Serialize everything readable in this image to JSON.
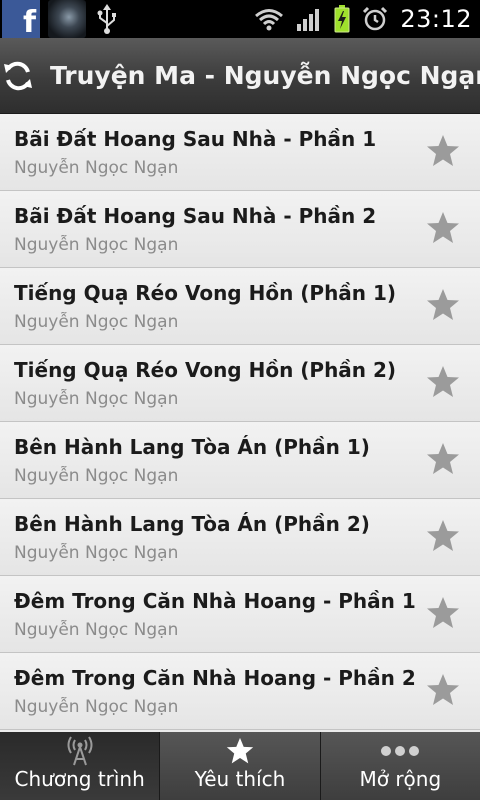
{
  "status_bar": {
    "facebook_icon": "facebook-icon",
    "time": "23:12"
  },
  "header": {
    "title": "Truyện Ma - Nguyễn Ngọc Ngạn",
    "refresh_icon": "refresh-icon"
  },
  "list": {
    "items": [
      {
        "title": "Bãi Đất Hoang Sau Nhà - Phần 1",
        "author": "Nguyễn Ngọc Ngạn"
      },
      {
        "title": "Bãi Đất Hoang Sau Nhà - Phần 2",
        "author": "Nguyễn Ngọc Ngạn"
      },
      {
        "title": "Tiếng Quạ Réo Vong Hồn (Phần 1)",
        "author": "Nguyễn Ngọc Ngạn"
      },
      {
        "title": "Tiếng Quạ Réo Vong Hồn (Phần 2)",
        "author": "Nguyễn Ngọc Ngạn"
      },
      {
        "title": "Bên Hành Lang Tòa Án (Phần 1)",
        "author": "Nguyễn Ngọc Ngạn"
      },
      {
        "title": "Bên Hành Lang Tòa Án (Phần 2)",
        "author": "Nguyễn Ngọc Ngạn"
      },
      {
        "title": "Đêm Trong Căn Nhà Hoang - Phần 1",
        "author": "Nguyễn Ngọc Ngạn"
      },
      {
        "title": "Đêm Trong Căn Nhà Hoang - Phần 2",
        "author": "Nguyễn Ngọc Ngạn"
      }
    ]
  },
  "tabs": [
    {
      "label": "Chương trình",
      "icon": "broadcast-icon",
      "active": true
    },
    {
      "label": "Yêu thích",
      "icon": "star-icon",
      "active": false
    },
    {
      "label": "Mở rộng",
      "icon": "more-icon",
      "active": false
    }
  ],
  "colors": {
    "title_bar": "#3c3c3c",
    "list_background": "#ececec",
    "star": "#9b9b9b",
    "tab_bar": "#2b2b2b"
  }
}
